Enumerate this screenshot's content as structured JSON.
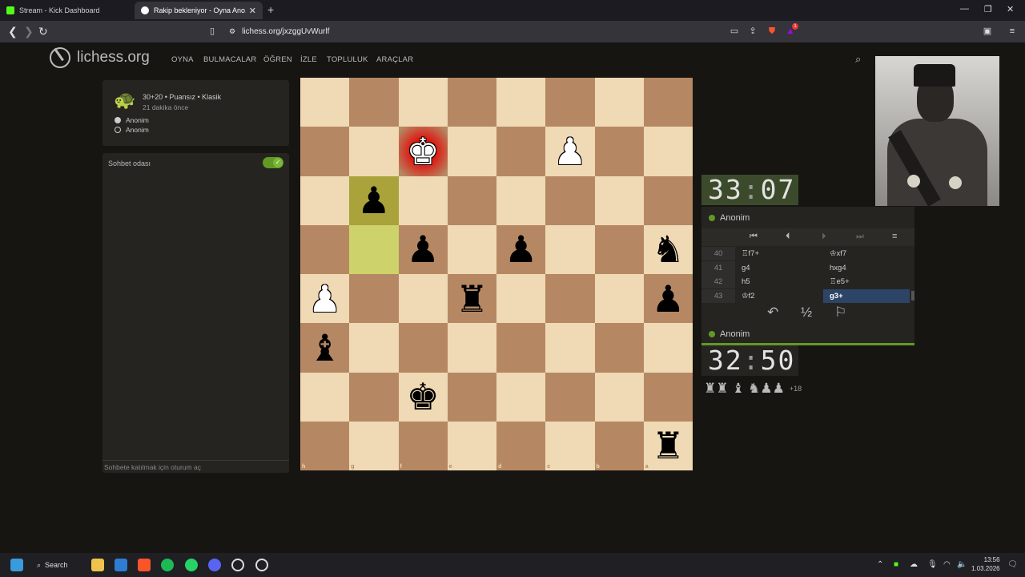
{
  "browser": {
    "tabs": [
      {
        "title": "Stream - Kick Dashboard",
        "favicon_color": "#53fc18"
      },
      {
        "title": "Rakip bekleniyor - Oyna Ano...",
        "favicon_color": "#ffffff"
      }
    ],
    "url": "lichess.org/jxzggUvWurlf",
    "icons": [
      "back-icon",
      "forward-icon",
      "reload-icon",
      "bookmark-icon",
      "site-info-icon",
      "cast-icon",
      "share-icon",
      "brave-shield-icon",
      "brave-rewards-icon",
      "sidebar-icon",
      "menu-icon"
    ],
    "rewards_badge": "1"
  },
  "site": {
    "logo": "lichess.org",
    "nav": [
      "OYNA",
      "BULMACALAR",
      "ÖĞREN",
      "İZLE",
      "TOPLULUK",
      "ARAÇLAR"
    ]
  },
  "game_meta": {
    "mode": "30+20 • Puansız • Klasik",
    "time_ago": "21 dakika önce",
    "players": [
      {
        "name": "Anonim",
        "color": "white"
      },
      {
        "name": "Anonim",
        "color": "black"
      }
    ]
  },
  "chat": {
    "title": "Sohbet odası",
    "enabled": true,
    "footer": "Sohbete katılmak için oturum aç"
  },
  "board": {
    "orientation": "black",
    "files_label": [
      "h",
      "g",
      "f",
      "e",
      "d",
      "c",
      "b",
      "a"
    ],
    "ranks_label": [
      "1",
      "2",
      "3",
      "4",
      "5",
      "6",
      "7",
      "8"
    ],
    "check_square": "f2",
    "last_move": [
      "g4",
      "g3"
    ],
    "pieces": [
      {
        "square": "f2",
        "glyph": "♚",
        "side": "w",
        "name": "white-king"
      },
      {
        "square": "c2",
        "glyph": "♟",
        "side": "w",
        "name": "white-pawn"
      },
      {
        "square": "g3",
        "glyph": "♟",
        "side": "b",
        "name": "black-pawn"
      },
      {
        "square": "f4",
        "glyph": "♟",
        "side": "b",
        "name": "black-pawn"
      },
      {
        "square": "d4",
        "glyph": "♟",
        "side": "b",
        "name": "black-pawn"
      },
      {
        "square": "a4",
        "glyph": "♞",
        "side": "b",
        "name": "black-knight"
      },
      {
        "square": "h5",
        "glyph": "♟",
        "side": "w",
        "name": "white-pawn"
      },
      {
        "square": "e5",
        "glyph": "♜",
        "side": "b",
        "name": "black-rook"
      },
      {
        "square": "a5",
        "glyph": "♟",
        "side": "b",
        "name": "black-pawn"
      },
      {
        "square": "h6",
        "glyph": "♝",
        "side": "b",
        "name": "black-bishop"
      },
      {
        "square": "f7",
        "glyph": "♚",
        "side": "b",
        "name": "black-king"
      },
      {
        "square": "a8",
        "glyph": "♜",
        "side": "b",
        "name": "black-rook"
      }
    ]
  },
  "clocks": {
    "top": {
      "min": "33",
      "sec": "07"
    },
    "bottom": {
      "min": "32",
      "sec": "50"
    }
  },
  "panel": {
    "top_player": "Anonim",
    "bottom_player": "Anonim",
    "moves": [
      {
        "n": "40",
        "w": "♖f7+",
        "b": "♔xf7"
      },
      {
        "n": "41",
        "w": "g4",
        "b": "hxg4"
      },
      {
        "n": "42",
        "w": "h5",
        "b": "♖e5+"
      },
      {
        "n": "43",
        "w": "♔f2",
        "b": "g3+"
      }
    ],
    "captured": "♜♜ ♝ ♞♟♟",
    "captured_extra": "+18",
    "controls": [
      "first-move-icon",
      "prev-move-icon",
      "next-move-icon",
      "last-move-icon",
      "hamburger-menu-icon"
    ],
    "actions": [
      "takeback-icon",
      "draw-offer",
      "resign-flag-icon"
    ],
    "draw_label": "½"
  },
  "taskbar": {
    "search": "Search",
    "time": "13:56",
    "date": "1.03.2026"
  }
}
